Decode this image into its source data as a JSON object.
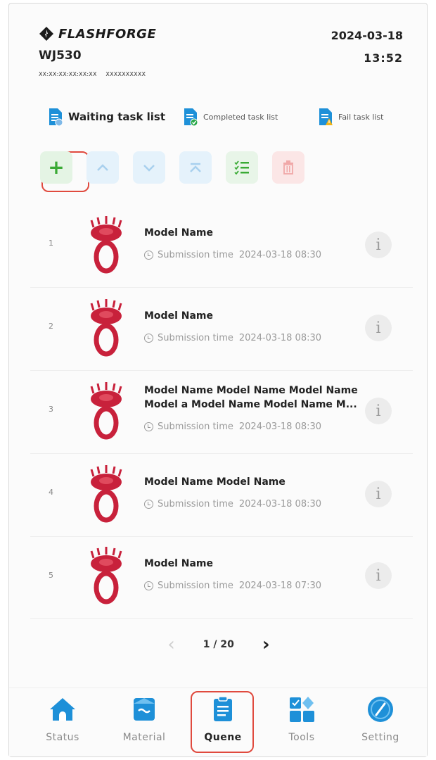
{
  "header": {
    "brand": "FLASHFORGE",
    "device_name": "WJ530",
    "mac": "XX:XX:XX:XX:XX:XX",
    "serial": "XXXXXXXXXX",
    "date": "2024-03-18",
    "time": "13:52"
  },
  "tabs": [
    {
      "label": "Waiting task list",
      "icon": "doc-clock-icon"
    },
    {
      "label": "Completed task list",
      "icon": "doc-check-icon"
    },
    {
      "label": "Fail task list",
      "icon": "doc-warning-icon"
    }
  ],
  "toolbar": {
    "add": "+",
    "icons": [
      "add-icon",
      "move-up-icon",
      "move-down-icon",
      "move-top-icon",
      "select-all-icon",
      "delete-icon"
    ]
  },
  "tasks": [
    {
      "num": "1",
      "title": "Model Name",
      "meta_label": "Submission time",
      "time": "2024-03-18  08:30",
      "info": "i"
    },
    {
      "num": "2",
      "title": "Model Name",
      "meta_label": "Submission time",
      "time": "2024-03-18  08:30",
      "info": "i"
    },
    {
      "num": "3",
      "title": "Model Name Model Name Model Name Model a Model Name Model Name M...",
      "meta_label": "Submission time",
      "time": "2024-03-18  08:30",
      "info": "i"
    },
    {
      "num": "4",
      "title": "Model Name Model Name",
      "meta_label": "Submission time",
      "time": "2024-03-18  08:30",
      "info": "i"
    },
    {
      "num": "5",
      "title": "Model Name",
      "meta_label": "Submission time",
      "time": "2024-03-18  07:30",
      "info": "i"
    }
  ],
  "pager": {
    "prev": "‹",
    "page": "1 / 20",
    "next": "›"
  },
  "nav": [
    {
      "label": "Status",
      "icon": "home-icon"
    },
    {
      "label": "Material",
      "icon": "material-icon"
    },
    {
      "label": "Quene",
      "icon": "queue-icon",
      "active": true
    },
    {
      "label": "Tools",
      "icon": "tools-icon"
    },
    {
      "label": "Setting",
      "icon": "gauge-icon"
    }
  ],
  "colors": {
    "accent_blue": "#1e90d8",
    "highlight_red": "#e04a3e",
    "add_green": "#3aaa35",
    "ring_red": "#c8213b"
  }
}
